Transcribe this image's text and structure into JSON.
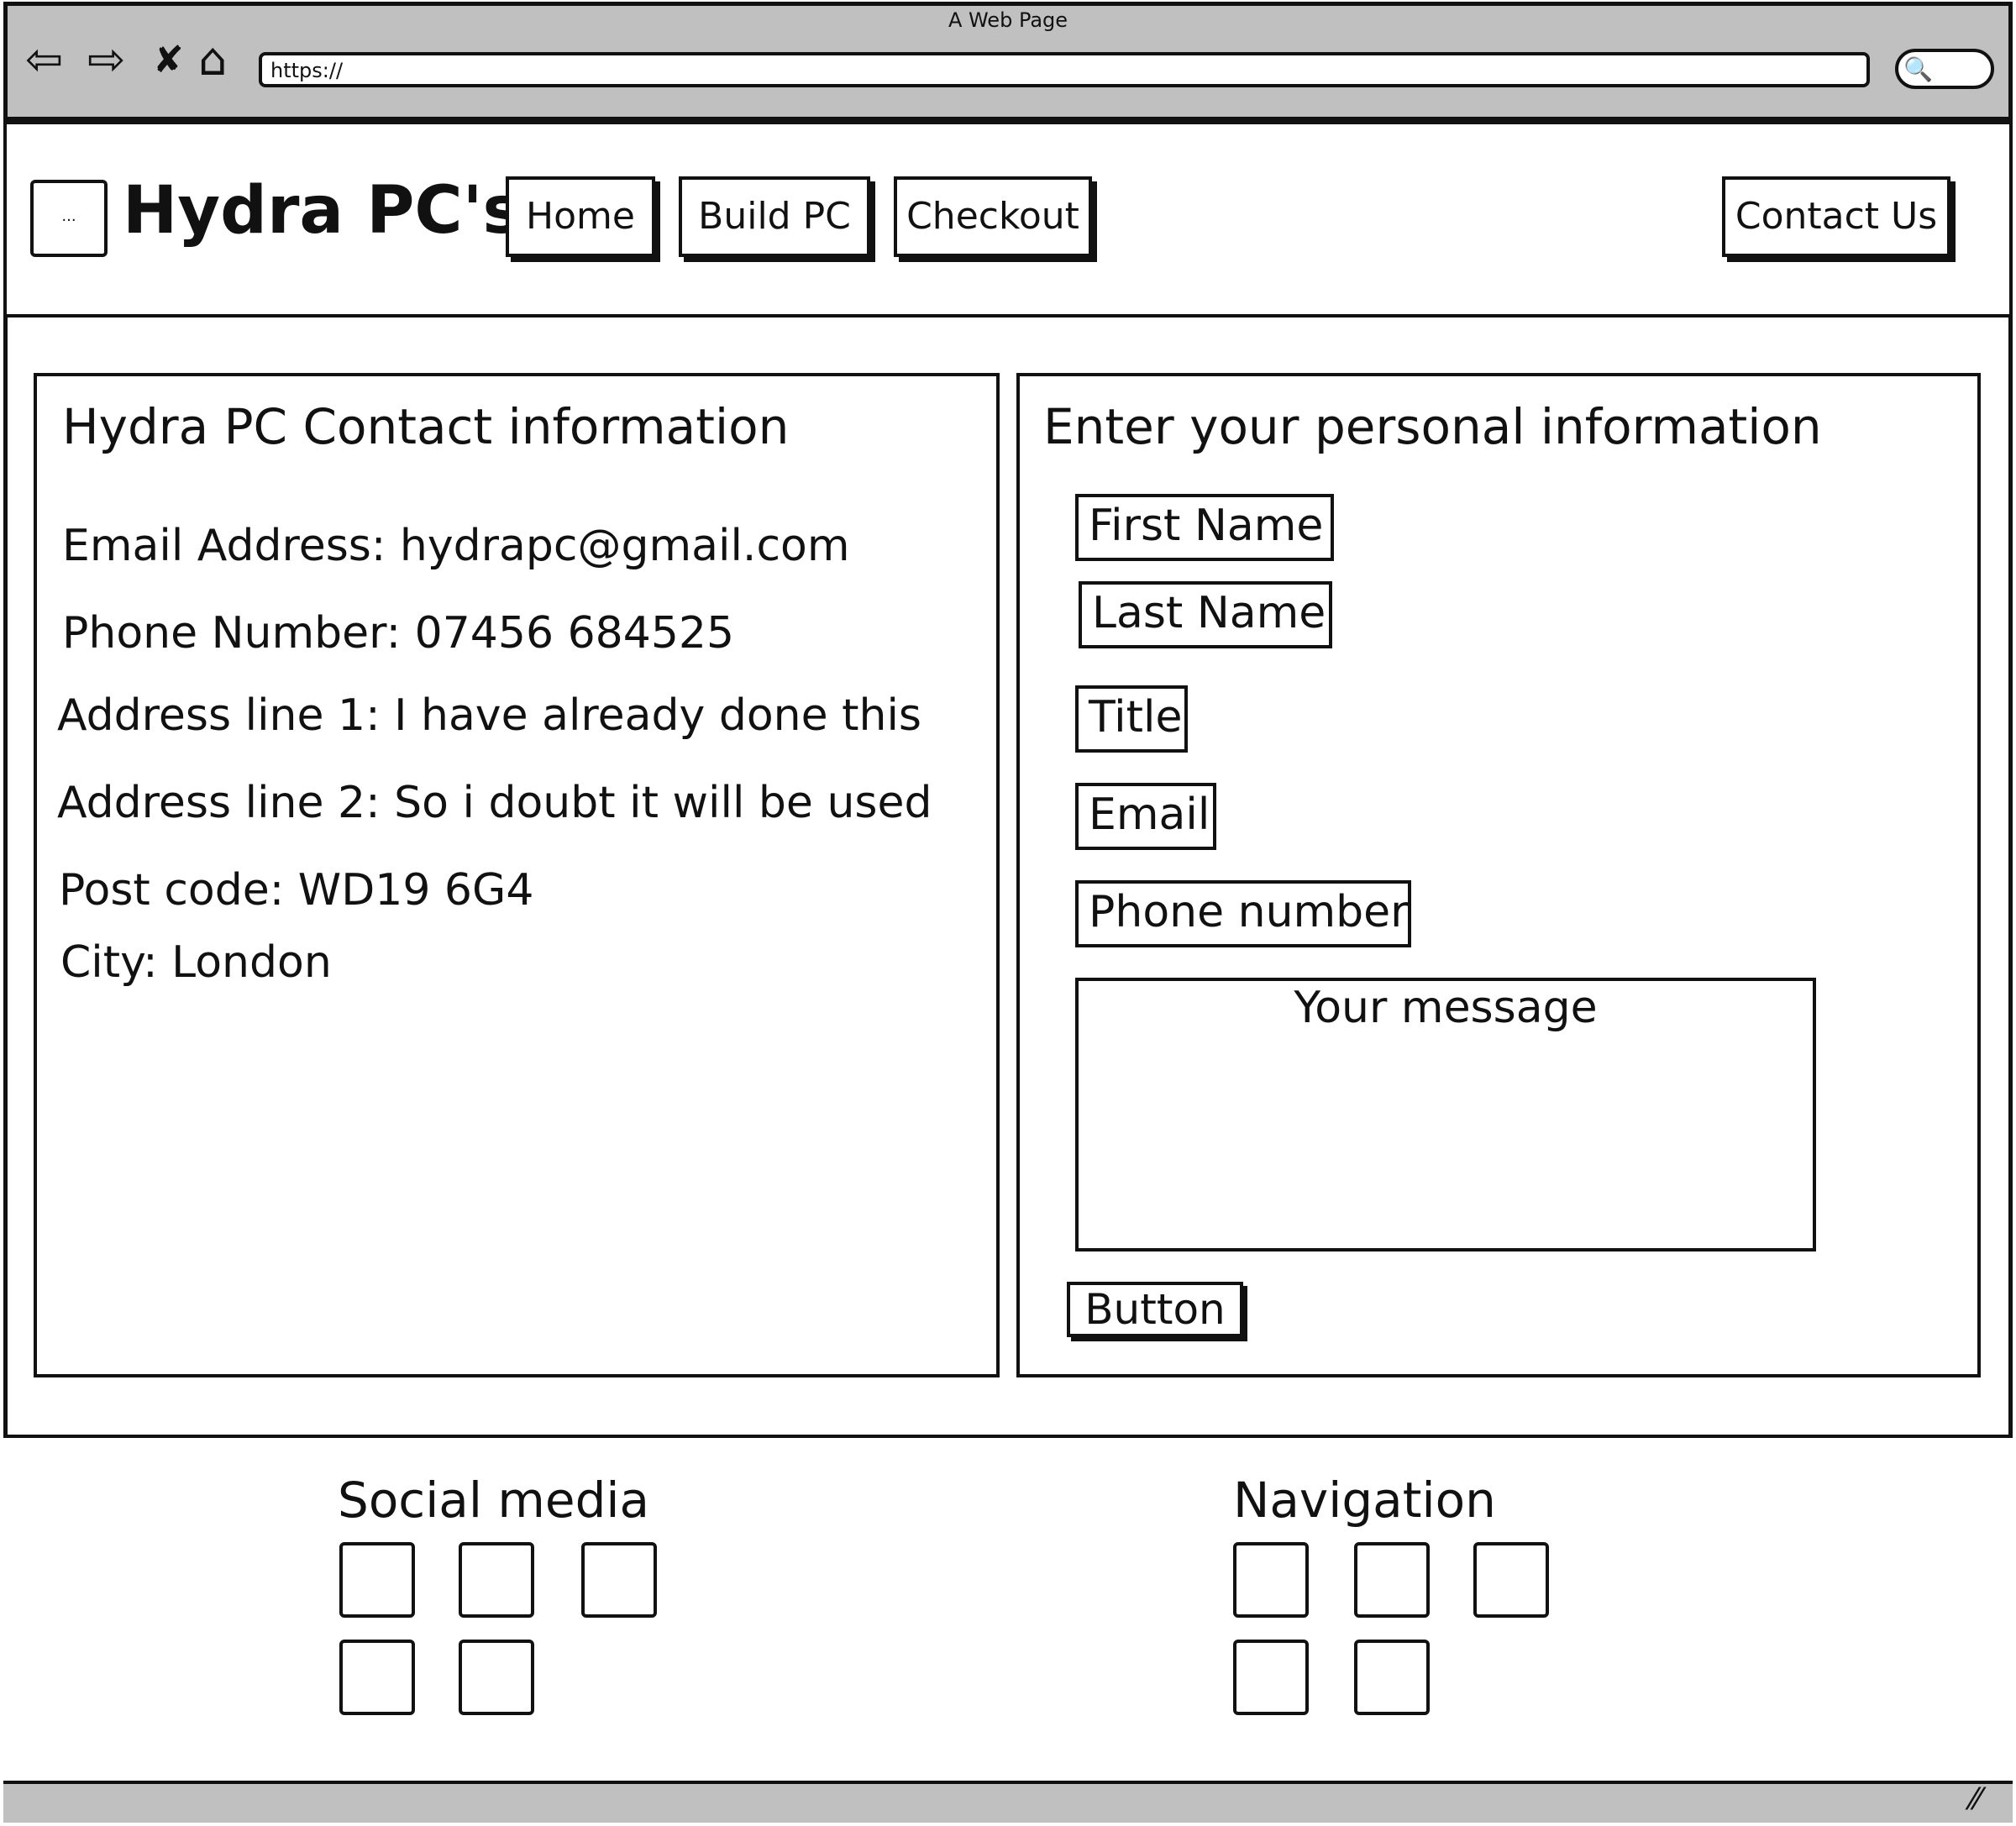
{
  "window": {
    "title": "A Web Page",
    "url": "https://",
    "back_icon": "⇦",
    "forward_icon": "⇨",
    "stop_icon": "✘",
    "home_icon": "⌂",
    "search_icon": "🔍"
  },
  "header": {
    "logo_placeholder": "...",
    "brand": "Hydra PC's",
    "nav": {
      "home": "Home",
      "build": "Build PC",
      "checkout": "Checkout",
      "contact": "Contact Us"
    }
  },
  "contact_info": {
    "title": "Hydra PC Contact information",
    "email": "Email Address: hydrapc@gmail.com",
    "phone": "Phone Number: 07456 684525",
    "address1": "Address line 1: I have already done this",
    "address2": "Address line 2: So i doubt it will be used",
    "postcode": "Post code: WD19 6G4",
    "city": "City: London"
  },
  "form": {
    "title": "Enter your personal information",
    "first_name": "First Name",
    "last_name": "Last Name",
    "title_field": "Title",
    "email": "Email",
    "phone": "Phone number",
    "message": "Your message",
    "submit": "Button"
  },
  "footer": {
    "social_title": "Social media",
    "nav_title": "Navigation"
  },
  "resize_icon": "⁄⁄"
}
